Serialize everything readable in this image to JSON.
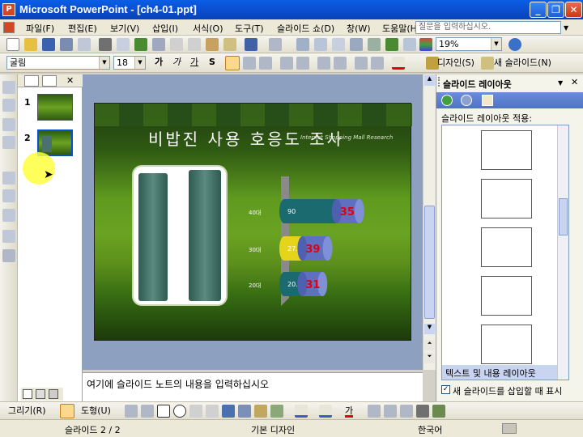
{
  "window": {
    "title": "Microsoft PowerPoint - [ch4-01.ppt]",
    "minimize": "_",
    "restore": "❐",
    "close": "✕"
  },
  "menu": {
    "items": [
      "파일(F)",
      "편집(E)",
      "보기(V)",
      "삽입(I)",
      "서식(O)",
      "도구(T)",
      "슬라이드 쇼(D)",
      "창(W)",
      "도움말(H)"
    ],
    "ask_placeholder": "질문을 입력하십시오."
  },
  "toolbar": {
    "zoom": "19%",
    "font": "굴림",
    "size": "18",
    "bold": "가",
    "italic": "가",
    "underline": "가",
    "shadow": "S",
    "design_label": "디자인(S)",
    "new_slide_label": "새 슬라이드(N)"
  },
  "thumbs": {
    "slide1_num": "1",
    "slide2_num": "2",
    "close": "✕"
  },
  "slide": {
    "title": "비밥진 사용 호응도 조사",
    "subtitle": "Internet Shopping Mall Research",
    "chart_data": {
      "type": "bar",
      "categories": [
        "40대",
        "30대",
        "20대"
      ],
      "series": [
        {
          "values": [
            90,
            27.4,
            20.4
          ]
        },
        {
          "values": [
            35,
            39,
            31
          ]
        }
      ]
    }
  },
  "notes": {
    "placeholder": "여기에 슬라이드 노트의 내용을 입력하십시오"
  },
  "taskpane": {
    "title": "슬라이드 레이아웃",
    "apply_label": "슬라이드 레이아웃 적용:",
    "highlighted": "텍스트 및 내용 레이아웃",
    "checkbox_label": "새 슬라이드를 삽입할 때 표시",
    "checked": true
  },
  "drawbar": {
    "draw_label": "그리기(R)",
    "autoshape_label": "도형(U)",
    "font_color_glyph": "가"
  },
  "status": {
    "slide": "슬라이드 2 / 2",
    "design": "기본 디자인",
    "language": "한국어"
  },
  "colors": {
    "title_blue": "#0b4fd0",
    "bar_teal": "#1a6a70",
    "bar_yellow": "#e6d41a",
    "bar_blue": "#6070c0",
    "value_red": "#e00010"
  }
}
